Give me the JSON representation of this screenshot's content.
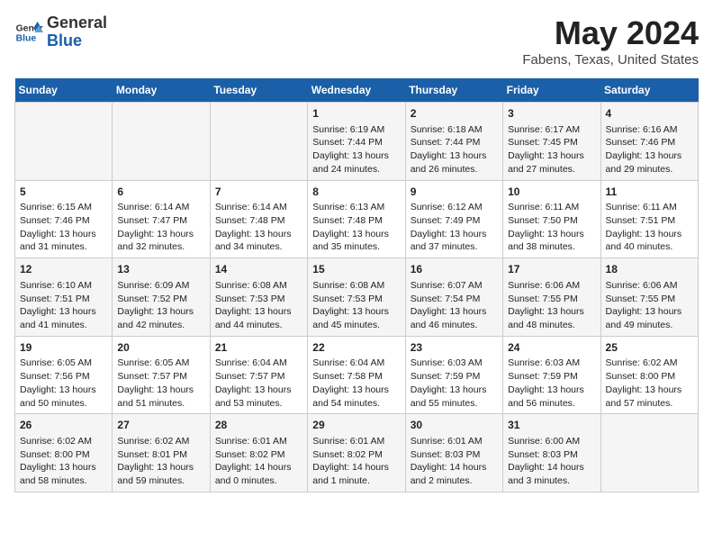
{
  "header": {
    "logo_general": "General",
    "logo_blue": "Blue",
    "title": "May 2024",
    "subtitle": "Fabens, Texas, United States"
  },
  "days_of_week": [
    "Sunday",
    "Monday",
    "Tuesday",
    "Wednesday",
    "Thursday",
    "Friday",
    "Saturday"
  ],
  "weeks": [
    [
      {
        "day": "",
        "info": ""
      },
      {
        "day": "",
        "info": ""
      },
      {
        "day": "",
        "info": ""
      },
      {
        "day": "1",
        "info": "Sunrise: 6:19 AM\nSunset: 7:44 PM\nDaylight: 13 hours\nand 24 minutes."
      },
      {
        "day": "2",
        "info": "Sunrise: 6:18 AM\nSunset: 7:44 PM\nDaylight: 13 hours\nand 26 minutes."
      },
      {
        "day": "3",
        "info": "Sunrise: 6:17 AM\nSunset: 7:45 PM\nDaylight: 13 hours\nand 27 minutes."
      },
      {
        "day": "4",
        "info": "Sunrise: 6:16 AM\nSunset: 7:46 PM\nDaylight: 13 hours\nand 29 minutes."
      }
    ],
    [
      {
        "day": "5",
        "info": "Sunrise: 6:15 AM\nSunset: 7:46 PM\nDaylight: 13 hours\nand 31 minutes."
      },
      {
        "day": "6",
        "info": "Sunrise: 6:14 AM\nSunset: 7:47 PM\nDaylight: 13 hours\nand 32 minutes."
      },
      {
        "day": "7",
        "info": "Sunrise: 6:14 AM\nSunset: 7:48 PM\nDaylight: 13 hours\nand 34 minutes."
      },
      {
        "day": "8",
        "info": "Sunrise: 6:13 AM\nSunset: 7:48 PM\nDaylight: 13 hours\nand 35 minutes."
      },
      {
        "day": "9",
        "info": "Sunrise: 6:12 AM\nSunset: 7:49 PM\nDaylight: 13 hours\nand 37 minutes."
      },
      {
        "day": "10",
        "info": "Sunrise: 6:11 AM\nSunset: 7:50 PM\nDaylight: 13 hours\nand 38 minutes."
      },
      {
        "day": "11",
        "info": "Sunrise: 6:11 AM\nSunset: 7:51 PM\nDaylight: 13 hours\nand 40 minutes."
      }
    ],
    [
      {
        "day": "12",
        "info": "Sunrise: 6:10 AM\nSunset: 7:51 PM\nDaylight: 13 hours\nand 41 minutes."
      },
      {
        "day": "13",
        "info": "Sunrise: 6:09 AM\nSunset: 7:52 PM\nDaylight: 13 hours\nand 42 minutes."
      },
      {
        "day": "14",
        "info": "Sunrise: 6:08 AM\nSunset: 7:53 PM\nDaylight: 13 hours\nand 44 minutes."
      },
      {
        "day": "15",
        "info": "Sunrise: 6:08 AM\nSunset: 7:53 PM\nDaylight: 13 hours\nand 45 minutes."
      },
      {
        "day": "16",
        "info": "Sunrise: 6:07 AM\nSunset: 7:54 PM\nDaylight: 13 hours\nand 46 minutes."
      },
      {
        "day": "17",
        "info": "Sunrise: 6:06 AM\nSunset: 7:55 PM\nDaylight: 13 hours\nand 48 minutes."
      },
      {
        "day": "18",
        "info": "Sunrise: 6:06 AM\nSunset: 7:55 PM\nDaylight: 13 hours\nand 49 minutes."
      }
    ],
    [
      {
        "day": "19",
        "info": "Sunrise: 6:05 AM\nSunset: 7:56 PM\nDaylight: 13 hours\nand 50 minutes."
      },
      {
        "day": "20",
        "info": "Sunrise: 6:05 AM\nSunset: 7:57 PM\nDaylight: 13 hours\nand 51 minutes."
      },
      {
        "day": "21",
        "info": "Sunrise: 6:04 AM\nSunset: 7:57 PM\nDaylight: 13 hours\nand 53 minutes."
      },
      {
        "day": "22",
        "info": "Sunrise: 6:04 AM\nSunset: 7:58 PM\nDaylight: 13 hours\nand 54 minutes."
      },
      {
        "day": "23",
        "info": "Sunrise: 6:03 AM\nSunset: 7:59 PM\nDaylight: 13 hours\nand 55 minutes."
      },
      {
        "day": "24",
        "info": "Sunrise: 6:03 AM\nSunset: 7:59 PM\nDaylight: 13 hours\nand 56 minutes."
      },
      {
        "day": "25",
        "info": "Sunrise: 6:02 AM\nSunset: 8:00 PM\nDaylight: 13 hours\nand 57 minutes."
      }
    ],
    [
      {
        "day": "26",
        "info": "Sunrise: 6:02 AM\nSunset: 8:00 PM\nDaylight: 13 hours\nand 58 minutes."
      },
      {
        "day": "27",
        "info": "Sunrise: 6:02 AM\nSunset: 8:01 PM\nDaylight: 13 hours\nand 59 minutes."
      },
      {
        "day": "28",
        "info": "Sunrise: 6:01 AM\nSunset: 8:02 PM\nDaylight: 14 hours\nand 0 minutes."
      },
      {
        "day": "29",
        "info": "Sunrise: 6:01 AM\nSunset: 8:02 PM\nDaylight: 14 hours\nand 1 minute."
      },
      {
        "day": "30",
        "info": "Sunrise: 6:01 AM\nSunset: 8:03 PM\nDaylight: 14 hours\nand 2 minutes."
      },
      {
        "day": "31",
        "info": "Sunrise: 6:00 AM\nSunset: 8:03 PM\nDaylight: 14 hours\nand 3 minutes."
      },
      {
        "day": "",
        "info": ""
      }
    ]
  ]
}
